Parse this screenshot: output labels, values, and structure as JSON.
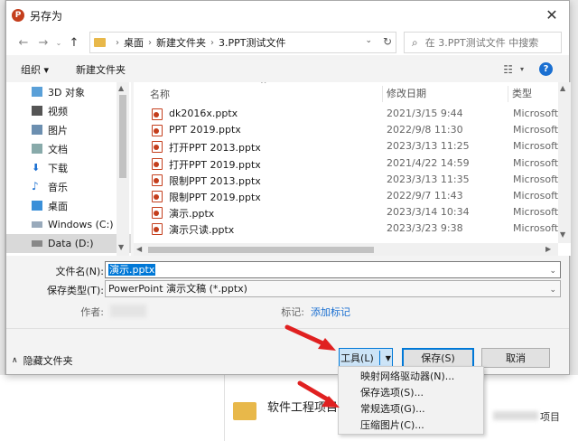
{
  "dialog": {
    "title": "另存为",
    "app_icon_letter": "P"
  },
  "nav": {
    "breadcrumb": [
      "桌面",
      "新建文件夹",
      "3.PPT测试文件"
    ],
    "search_placeholder": "在 3.PPT测试文件 中搜索"
  },
  "toolbar": {
    "organize": "组织 ▾",
    "new_folder": "新建文件夹"
  },
  "sidebar": {
    "items": [
      {
        "label": "3D 对象",
        "icon": "cube-icon"
      },
      {
        "label": "视频",
        "icon": "video-icon"
      },
      {
        "label": "图片",
        "icon": "picture-icon"
      },
      {
        "label": "文档",
        "icon": "document-icon"
      },
      {
        "label": "下载",
        "icon": "download-icon"
      },
      {
        "label": "音乐",
        "icon": "music-icon"
      },
      {
        "label": "桌面",
        "icon": "desktop-icon"
      },
      {
        "label": "Windows (C:)",
        "icon": "drive-icon"
      },
      {
        "label": "Data (D:)",
        "icon": "drive-icon",
        "selected": true
      }
    ]
  },
  "files": {
    "columns": [
      "名称",
      "修改日期",
      "类型"
    ],
    "rows": [
      {
        "name": "dk2016x.pptx",
        "date": "2021/3/15 9:44",
        "type": "Microsoft"
      },
      {
        "name": "PPT 2019.pptx",
        "date": "2022/9/8 11:30",
        "type": "Microsoft"
      },
      {
        "name": "打开PPT 2013.pptx",
        "date": "2023/3/13 11:25",
        "type": "Microsoft"
      },
      {
        "name": "打开PPT 2019.pptx",
        "date": "2021/4/22 14:59",
        "type": "Microsoft"
      },
      {
        "name": "限制PPT 2013.pptx",
        "date": "2023/3/13 11:35",
        "type": "Microsoft"
      },
      {
        "name": "限制PPT 2019.pptx",
        "date": "2022/9/7 11:43",
        "type": "Microsoft"
      },
      {
        "name": "演示.pptx",
        "date": "2023/3/14 10:34",
        "type": "Microsoft"
      },
      {
        "name": "演示只读.pptx",
        "date": "2023/3/23 9:38",
        "type": "Microsoft"
      }
    ]
  },
  "form": {
    "filename_label": "文件名(N):",
    "filename_value": "演示.pptx",
    "filetype_label": "保存类型(T):",
    "filetype_value": "PowerPoint 演示文稿 (*.pptx)",
    "author_label": "作者:",
    "tags_label": "标记:",
    "tags_link": "添加标记"
  },
  "footer": {
    "hide_folders": "隐藏文件夹",
    "tools": "工具(L)",
    "save": "保存(S)",
    "cancel": "取消"
  },
  "tools_menu": {
    "items": [
      "映射网络驱动器(N)...",
      "保存选项(S)...",
      "常规选项(G)...",
      "压缩图片(C)..."
    ]
  },
  "background": {
    "folder_name": "软件工程项目",
    "truncated_text": "项目"
  },
  "colors": {
    "accent": "#0078d7",
    "arrow": "#e02020",
    "ppt": "#c43e1c"
  }
}
